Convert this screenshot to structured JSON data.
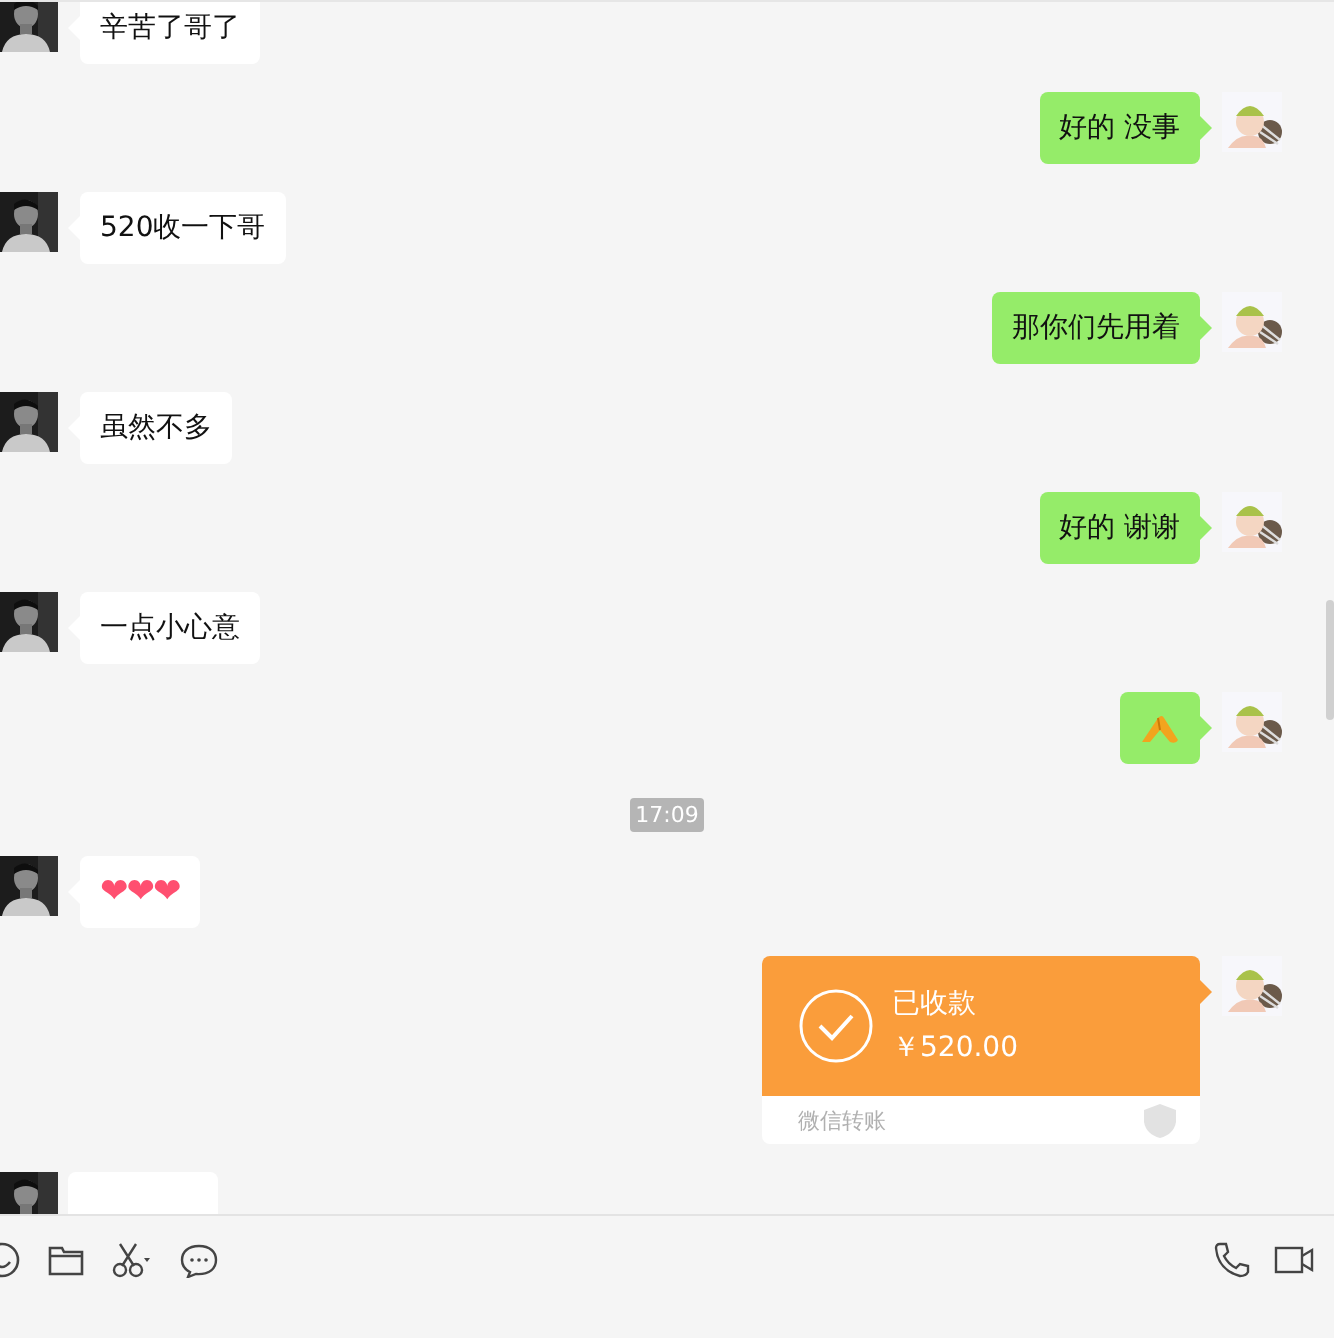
{
  "messages": [
    {
      "outgoing": false,
      "kind": "text",
      "text": "辛苦了哥了"
    },
    {
      "outgoing": true,
      "kind": "text",
      "text": "好的 没事"
    },
    {
      "outgoing": false,
      "kind": "text",
      "text": "520收一下哥"
    },
    {
      "outgoing": true,
      "kind": "text",
      "text": "那你们先用着"
    },
    {
      "outgoing": false,
      "kind": "text",
      "text": "虽然不多"
    },
    {
      "outgoing": true,
      "kind": "text",
      "text": "好的 谢谢"
    },
    {
      "outgoing": false,
      "kind": "text",
      "text": "一点小心意"
    },
    {
      "outgoing": true,
      "kind": "sticker"
    },
    {
      "kind": "time",
      "text": "17:09"
    },
    {
      "outgoing": false,
      "kind": "hearts",
      "text": "❤❤❤"
    },
    {
      "outgoing": true,
      "kind": "transfer",
      "status": "已收款",
      "amount": "￥520.00",
      "footer": "微信转账"
    },
    {
      "outgoing": false,
      "kind": "cut"
    }
  ]
}
